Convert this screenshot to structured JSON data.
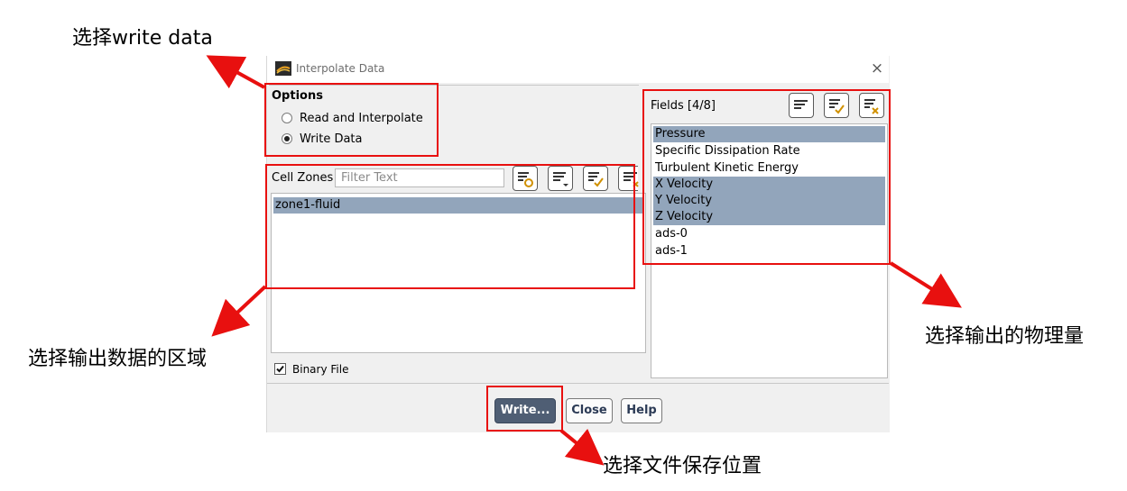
{
  "dialog": {
    "title": "Interpolate Data",
    "close_symbol": "×"
  },
  "options": {
    "label": "Options",
    "items": [
      {
        "label": "Read and Interpolate",
        "selected": false
      },
      {
        "label": "Write Data",
        "selected": true
      }
    ]
  },
  "cell_zones": {
    "label": "Cell Zones",
    "filter_placeholder": "Filter Text",
    "items": [
      {
        "label": "zone1-fluid",
        "selected": true
      }
    ]
  },
  "fields": {
    "label": "Fields [4/8]",
    "items": [
      {
        "label": "Pressure",
        "selected": true
      },
      {
        "label": "Specific Dissipation Rate",
        "selected": false
      },
      {
        "label": "Turbulent Kinetic Energy",
        "selected": false
      },
      {
        "label": "X Velocity",
        "selected": true
      },
      {
        "label": "Y Velocity",
        "selected": true
      },
      {
        "label": "Z Velocity",
        "selected": true
      },
      {
        "label": "ads-0",
        "selected": false
      },
      {
        "label": "ads-1",
        "selected": false
      }
    ]
  },
  "binary_file": {
    "label": "Binary File",
    "checked": true
  },
  "buttons": {
    "write": "Write...",
    "close": "Close",
    "help": "Help"
  },
  "annotations": {
    "write_data": "选择write data",
    "zones": "选择输出数据的区域",
    "fields": "选择输出的物理量",
    "save": "选择文件保存位置"
  },
  "colors": {
    "highlight": "#e8100f",
    "selection": "#92a5bb",
    "primary_button": "#4f5e74"
  }
}
